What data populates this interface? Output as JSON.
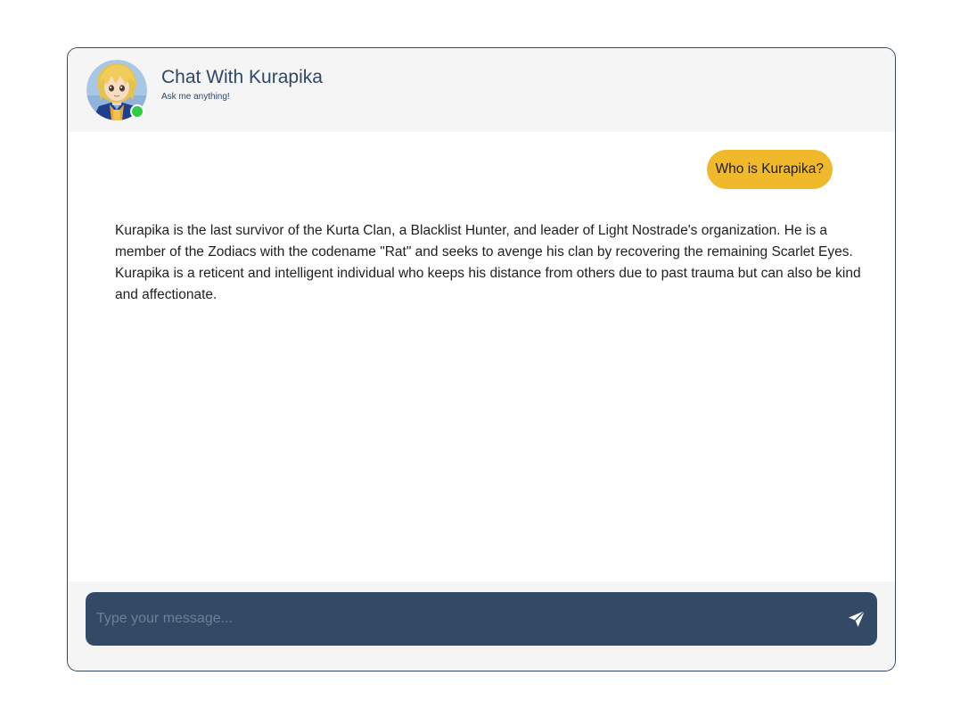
{
  "header": {
    "title": "Chat With Kurapika",
    "subtitle": "Ask me anything!",
    "status": "online",
    "status_color": "#2ecc40"
  },
  "messages": [
    {
      "role": "user",
      "text": "Who is Kurapika?"
    },
    {
      "role": "bot",
      "text": "Kurapika is the last survivor of the Kurta Clan, a Blacklist Hunter, and leader of Light Nostrade's organization. He is a member of the Zodiacs with the codename \"Rat\" and seeks to avenge his clan by recovering the remaining Scarlet Eyes. Kurapika is a reticent and intelligent individual who keeps his distance from others due to past trauma but can also be kind and affectionate."
    }
  ],
  "composer": {
    "placeholder": "Type your message...",
    "value": "",
    "send_icon": "send-icon"
  },
  "colors": {
    "accent": "#334a66",
    "user_bubble": "#f0b92c",
    "panel": "#f5f5f5"
  }
}
